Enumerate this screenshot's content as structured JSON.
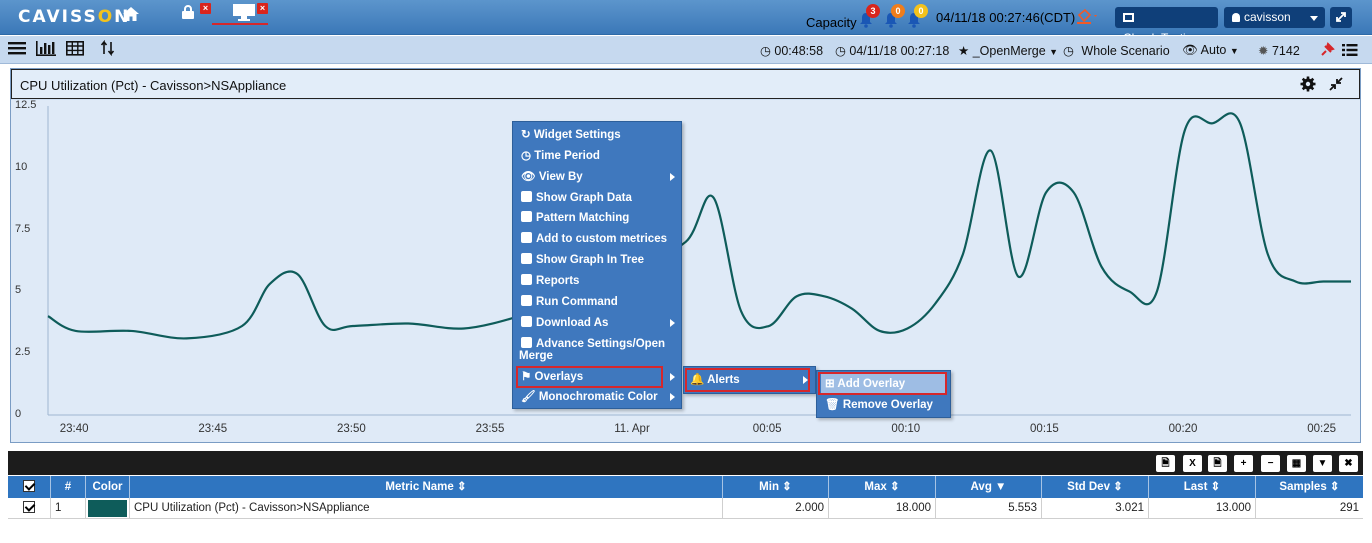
{
  "app": {
    "logo_text": "CAVISSON",
    "capacity_label": "Capacity",
    "bells": [
      {
        "count": "3",
        "color": "#d9251d"
      },
      {
        "count": "0",
        "color": "#ef7d1c"
      },
      {
        "count": "0",
        "color": "#f3c21c"
      }
    ],
    "datetime": "04/11/18 00:27:46(CDT)",
    "project_button": "Cloud_Testing",
    "user_button": "cavisson"
  },
  "toolbar": {
    "elapsed": "00:48:58",
    "timestamp": "04/11/18 00:27:18",
    "favorite": "_OpenMerge",
    "scope": "Whole Scenario",
    "view_mode": "Auto",
    "session_count": "7142"
  },
  "widget": {
    "title": "CPU Utilization (Pct) - Cavisson>NSAppliance"
  },
  "chart_data": {
    "type": "line",
    "y_ticks": [
      "12.5",
      "10",
      "7.5",
      "5",
      "2.5",
      "0"
    ],
    "ylim": [
      0,
      12.5
    ],
    "x_ticks": [
      "23:40",
      "23:45",
      "23:50",
      "23:55",
      "11. Apr",
      "00:05",
      "00:10",
      "00:15",
      "00:20",
      "00:25"
    ],
    "xlim": [
      "23:39",
      "00:26"
    ],
    "grid": false,
    "series": [
      {
        "color": "#0e5c5a",
        "x": [
          "23:39",
          "23:40",
          "23:42",
          "23:44",
          "23:46",
          "23:47",
          "23:48",
          "23:49",
          "23:50",
          "23:52",
          "23:54",
          "23:56",
          "23:57",
          "23:58",
          "00:00",
          "00:02",
          "00:03",
          "00:04",
          "00:05",
          "00:06",
          "00:07",
          "00:08",
          "00:09",
          "00:10",
          "00:11",
          "00:12",
          "00:13",
          "00:14",
          "00:15",
          "00:16",
          "00:17",
          "00:18",
          "00:19",
          "00:20",
          "00:21",
          "00:22",
          "00:23",
          "00:24",
          "00:25",
          "00:26"
        ],
        "values": [
          4.0,
          3.4,
          3.4,
          3.1,
          3.6,
          5.3,
          5.7,
          3.6,
          3.6,
          3.7,
          3.5,
          4.0,
          4.5,
          5.0,
          6.0,
          7.0,
          8.8,
          4.2,
          3.6,
          4.8,
          4.8,
          4.3,
          3.4,
          3.5,
          4.5,
          6.5,
          10.7,
          5.6,
          9.0,
          9.0,
          6.0,
          5.0,
          5.0,
          11.5,
          11.8,
          11.8,
          6.5,
          5.4,
          5.4,
          5.4
        ]
      }
    ]
  },
  "context_menu": {
    "items": [
      {
        "label": "Widget Settings",
        "icon": "refresh-icon"
      },
      {
        "label": "Time Period",
        "icon": "clock-icon"
      },
      {
        "label": "View By",
        "icon": "eye-icon",
        "submenu": true
      },
      {
        "label": "Show Graph Data",
        "icon": "chart-icon"
      },
      {
        "label": "Pattern Matching",
        "icon": "chart-icon"
      },
      {
        "label": "Add to custom metrices",
        "icon": "chart-icon"
      },
      {
        "label": "Show Graph In Tree",
        "icon": "chart-icon"
      },
      {
        "label": "Reports",
        "icon": "chart-icon"
      },
      {
        "label": "Run Command",
        "icon": "chart-icon"
      },
      {
        "label": "Download As",
        "icon": "chart-icon",
        "submenu": true
      },
      {
        "label": "Advance Settings/Open",
        "label2": "Merge",
        "icon": "chart-icon"
      },
      {
        "label": "Overlays",
        "icon": "flag-icon",
        "submenu": true
      },
      {
        "label": "Monochromatic Color",
        "icon": "brush-icon",
        "submenu": true
      }
    ],
    "submenu_alerts": "Alerts",
    "submenu_overlay": [
      "Add Overlay",
      "Remove Overlay"
    ]
  },
  "table": {
    "headers": [
      "#",
      "Color",
      "Metric Name",
      "Min",
      "Max",
      "Avg",
      "Std Dev",
      "Last",
      "Samples"
    ],
    "rows": [
      {
        "index": "1",
        "color": "#0e5c5a",
        "metric": "CPU Utilization (Pct) - Cavisson>NSAppliance",
        "min": "2.000",
        "max": "18.000",
        "avg": "5.553",
        "stddev": "3.021",
        "last": "13.000",
        "samples": "291"
      }
    ]
  }
}
